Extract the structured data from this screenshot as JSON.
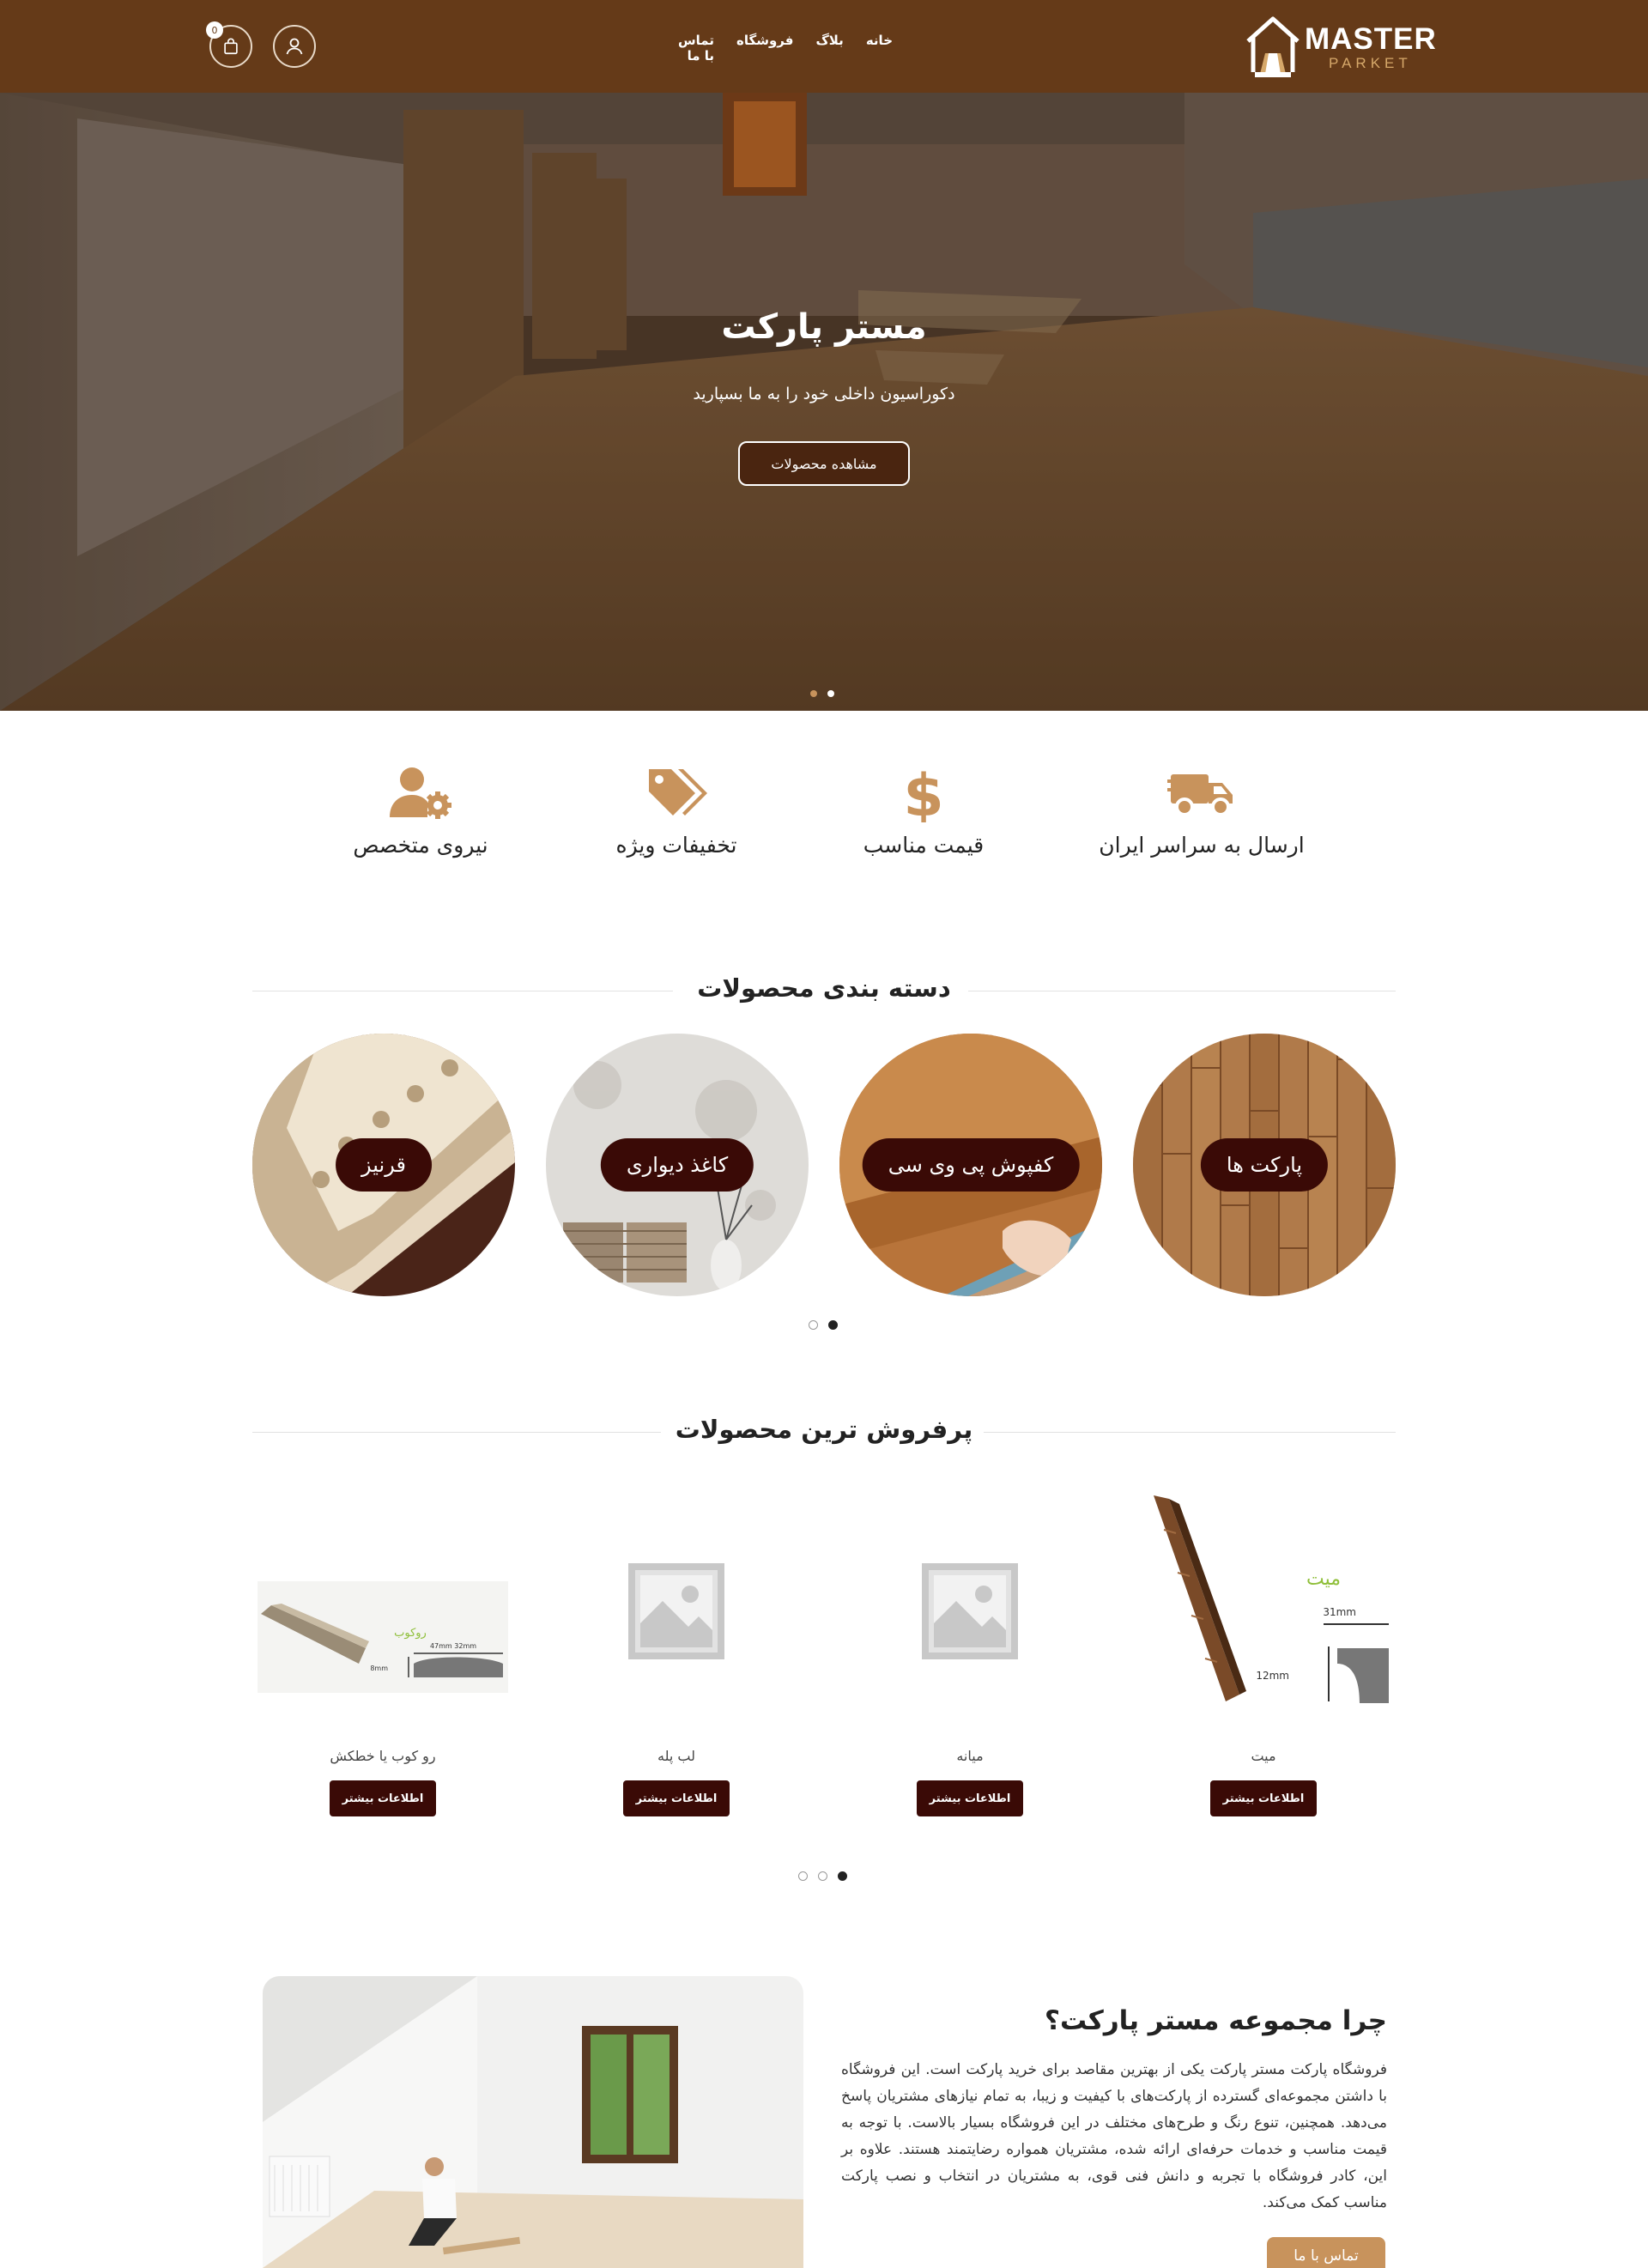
{
  "brand": {
    "name": "MASTER",
    "sub": "PARKET",
    "primary": "#653a18",
    "accent": "#c8935c",
    "dark": "#3a0a06"
  },
  "header": {
    "nav": [
      {
        "label": "خانه"
      },
      {
        "label": "بلاگ"
      },
      {
        "label": "فروشگاه"
      },
      {
        "label": "تماس با ما"
      }
    ],
    "cart_count": "0",
    "icons": {
      "user": "user-icon",
      "cart": "shopping-bag-icon"
    }
  },
  "hero": {
    "title": "مستر پارکت",
    "subtitle": "دکوراسیون داخلی خود را به ما بسپارید",
    "button": "مشاهده محصولات",
    "slides": 2,
    "active_slide": 2
  },
  "features": [
    {
      "label": "ارسال به سراسر ایران",
      "icon": "truck-icon"
    },
    {
      "label": "قیمت مناسب",
      "icon": "dollar-icon"
    },
    {
      "label": "تخفیفات ویژه",
      "icon": "tags-icon"
    },
    {
      "label": "نیروی متخصص",
      "icon": "user-gear-icon"
    }
  ],
  "categories": {
    "title": "دسته بندی محصولات",
    "items": [
      {
        "label": "پارکت ها"
      },
      {
        "label": "کفپوش پی وی سی"
      },
      {
        "label": "کاغذ دیواری"
      },
      {
        "label": "قرنیز"
      }
    ],
    "pages": 2,
    "active_page": 2
  },
  "products": {
    "title": "پرفروش ترین محصولات",
    "button_label": "اطلاعات بیشتر",
    "items": [
      {
        "name": "میت",
        "image_text": "میت",
        "dim_width": "31mm",
        "dim_height": "12mm"
      },
      {
        "name": "میانه"
      },
      {
        "name": "لب پله"
      },
      {
        "name": "رو کوب یا خطکش",
        "image_text": "روکوب",
        "dim_width": "47mm\n32mm",
        "dim_height": "8mm"
      }
    ],
    "pages": 3,
    "active_page": 3
  },
  "about": {
    "title": "چرا مجموعه مستر پارکت؟",
    "text": "فروشگاه پارکت مستر پارکت یکی از بهترین مقاصد برای خرید پارکت است. این فروشگاه با داشتن مجموعه‌ای گسترده از پارکت‌های با کیفیت و زیبا، به تمام نیازهای مشتریان پاسخ می‌دهد. همچنین، تنوع رنگ و طرح‌های مختلف در این فروشگاه بسیار بالاست. با توجه به قیمت مناسب و خدمات حرفه‌ای ارائه شده، مشتریان همواره رضایتمند هستند. علاوه بر این، کادر فروشگاه با تجربه و دانش فنی قوی، به مشتریان در انتخاب و نصب پارکت مناسب کمک می‌کند.",
    "button": "تماس با ما"
  }
}
